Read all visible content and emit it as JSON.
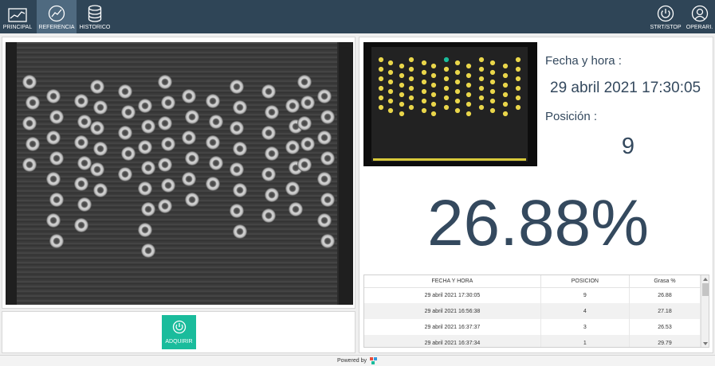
{
  "nav": {
    "principal": "PRINCIPAL",
    "referencia": "REFERENCIA",
    "historico": "HISTORICO",
    "strt_stop": "STRT/STOP",
    "operari": "OPERARI."
  },
  "info": {
    "fecha_label": "Fecha y hora :",
    "fecha_value": "29 abril 2021 17:30:05",
    "posicion_label": "Posición :",
    "posicion_value": "9",
    "percentage": "26.88%"
  },
  "acquire": {
    "label": "ADQUIRIR"
  },
  "table": {
    "headers": [
      "FECHA Y HORA",
      "POSICION",
      "Grasa %"
    ],
    "rows": [
      [
        "29 abril 2021 17:30:05",
        "9",
        "26.88"
      ],
      [
        "29 abril 2021 16:56:38",
        "4",
        "27.18"
      ],
      [
        "29 abril 2021 16:37:37",
        "3",
        "26.53"
      ],
      [
        "29 abril 2021 16:37:34",
        "1",
        "29.79"
      ]
    ]
  },
  "footer": {
    "powered": "Powered by"
  },
  "colors": {
    "topbar": "#2f4557",
    "active_tab": "#4f6a80",
    "accent": "#1abc9c",
    "text": "#34495e"
  },
  "icons": [
    "line-chart-icon",
    "trend-icon",
    "database-icon",
    "power-icon",
    "user-icon"
  ]
}
